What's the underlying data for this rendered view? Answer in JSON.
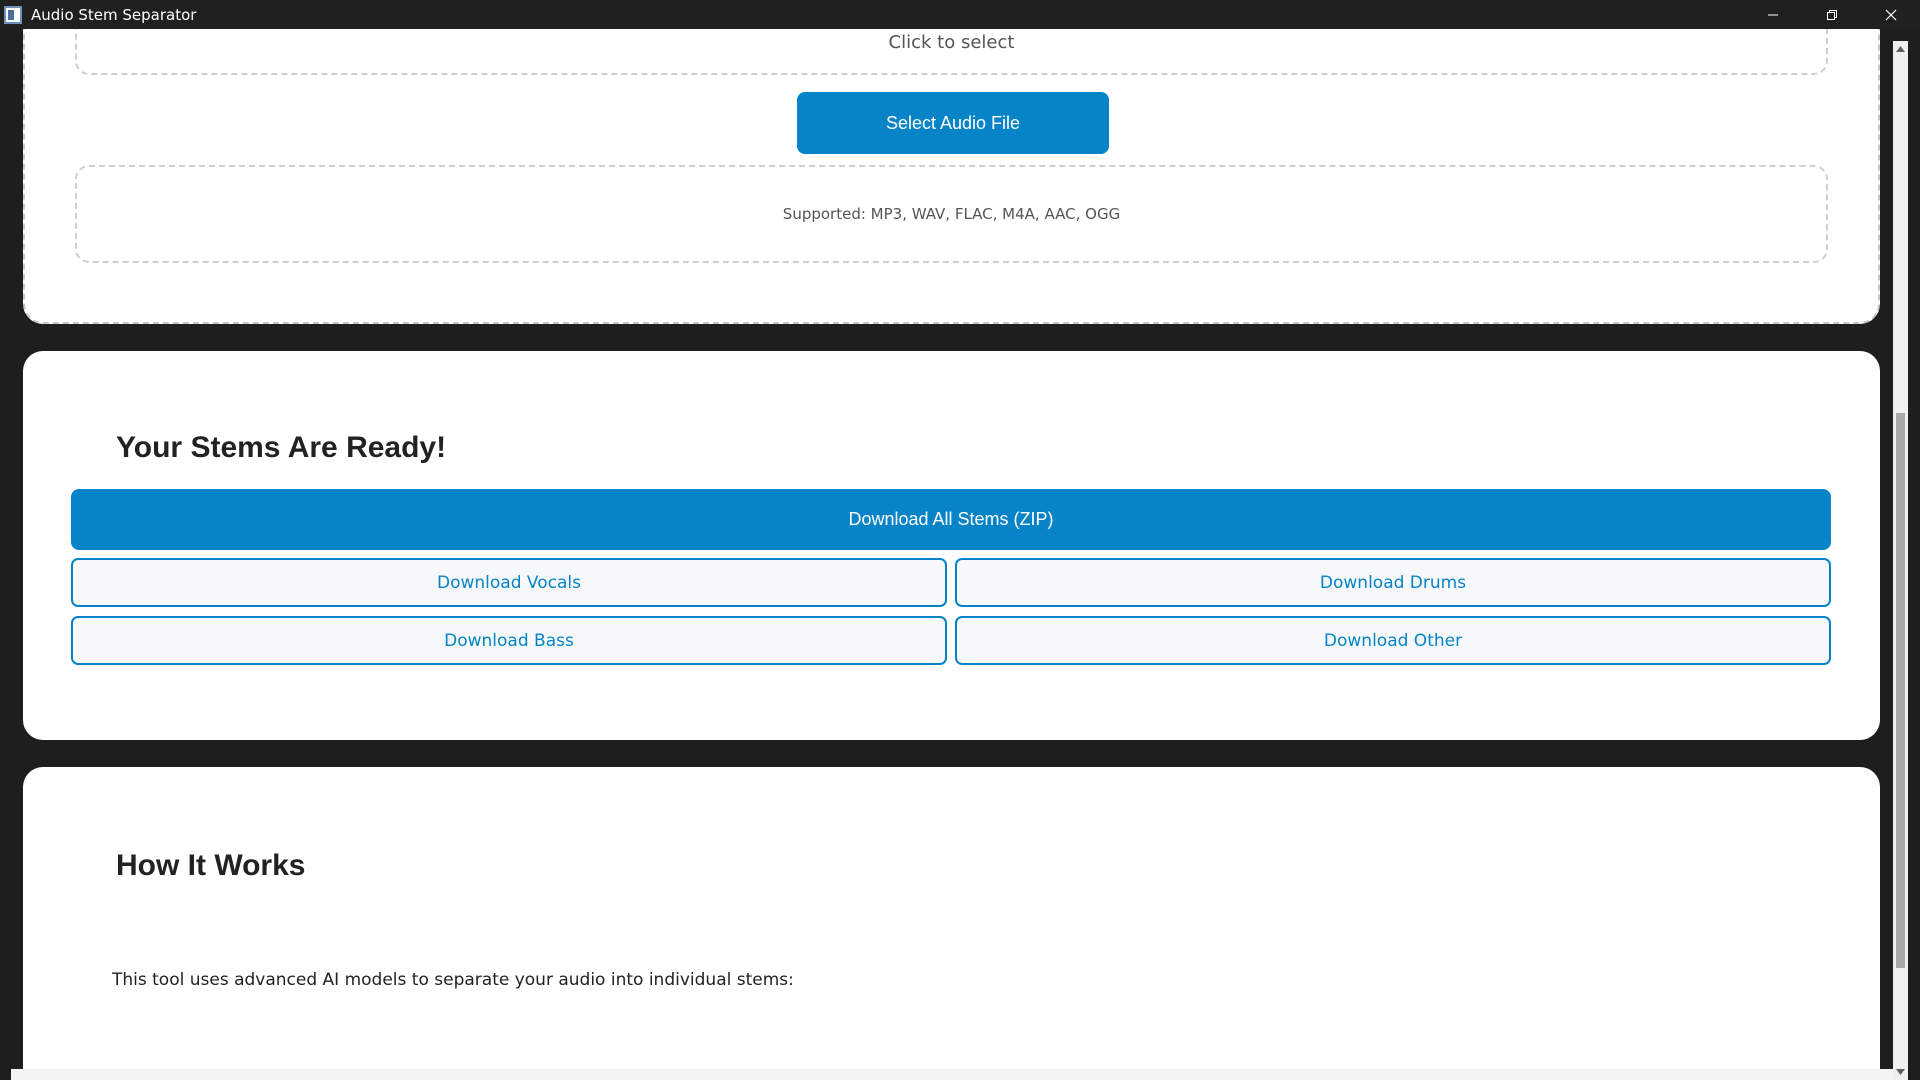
{
  "window": {
    "title": "Audio Stem Separator",
    "minimize_icon": "minimize-icon",
    "restore_icon": "restore-icon",
    "close_icon": "close-icon"
  },
  "upload": {
    "hint": "Click to select",
    "select_button_label": "Select Audio File",
    "supported_formats": "Supported: MP3, WAV, FLAC, M4A, AAC, OGG"
  },
  "results": {
    "title": "Your Stems Are Ready!",
    "download_all_label": "Download All Stems (ZIP)",
    "stems": [
      {
        "label": "Download Vocals"
      },
      {
        "label": "Download Drums"
      },
      {
        "label": "Download Bass"
      },
      {
        "label": "Download Other"
      }
    ]
  },
  "how_it_works": {
    "title": "How It Works",
    "description": "This tool uses advanced AI models to separate your audio into individual stems:"
  },
  "colors": {
    "accent": "#0783c8",
    "titlebar": "#202020",
    "background": "#1e1e1e",
    "card": "#ffffff"
  }
}
